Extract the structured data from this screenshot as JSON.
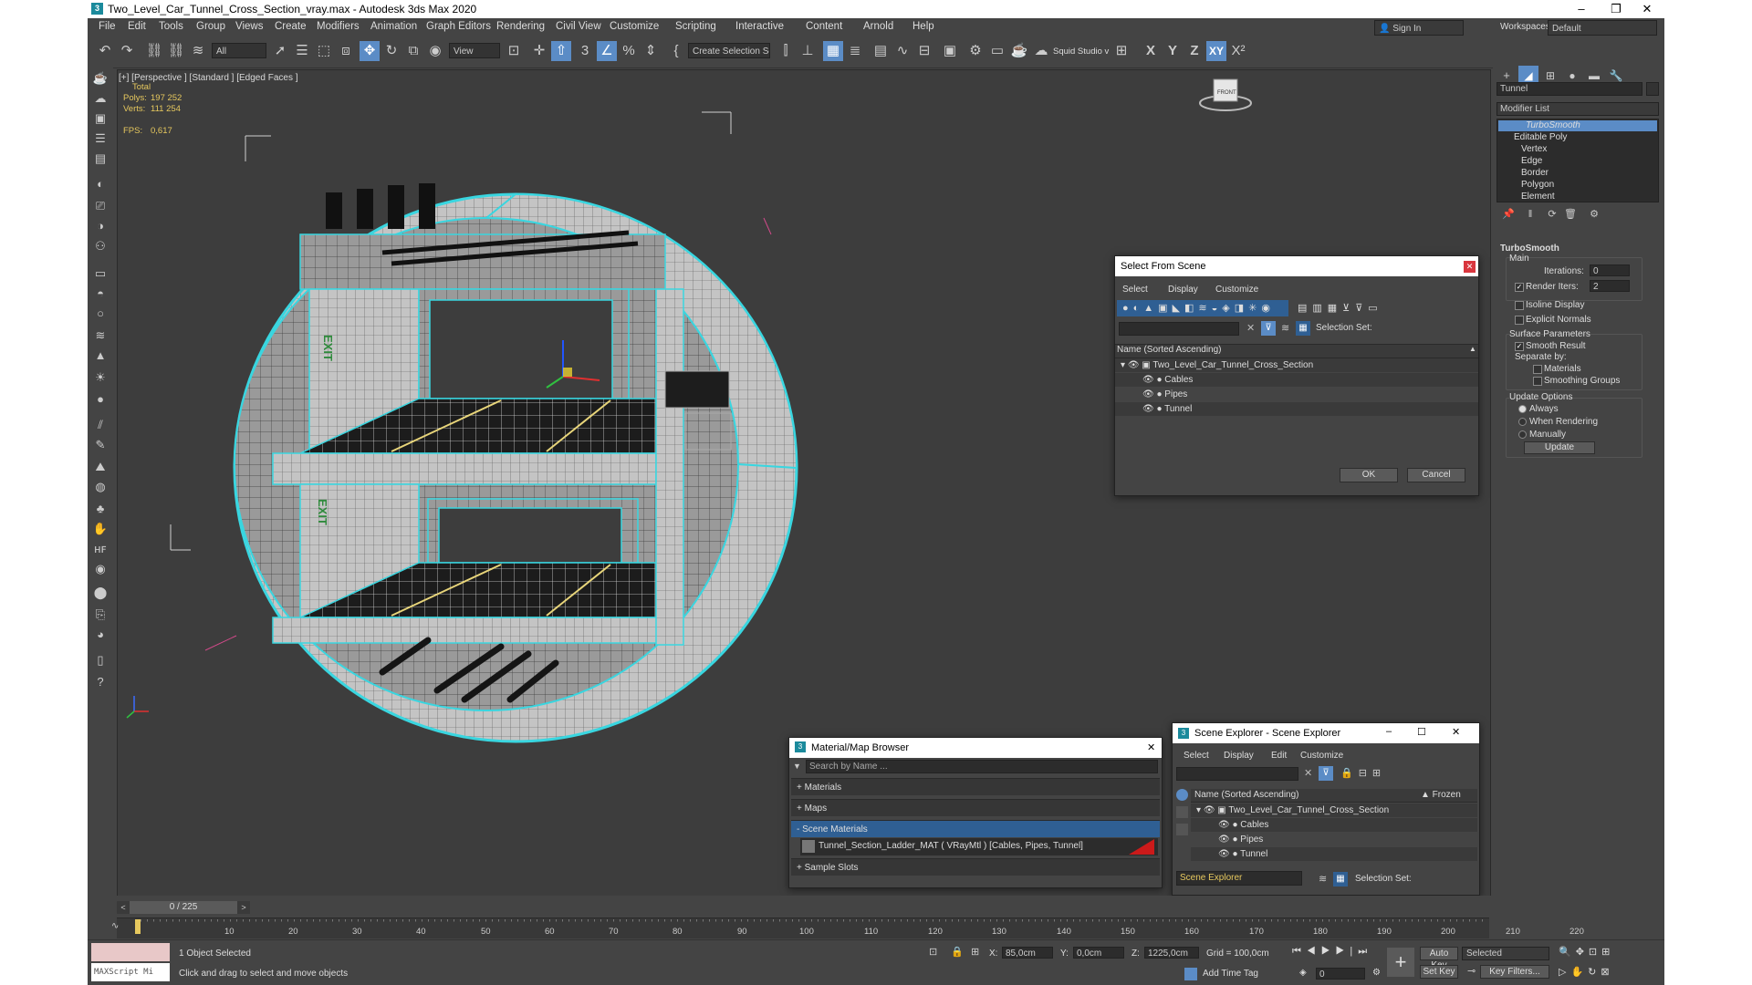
{
  "window": {
    "title": "Two_Level_Car_Tunnel_Cross_Section_vray.max - Autodesk 3ds Max 2020",
    "app_icon": "3"
  },
  "menu": [
    "File",
    "Edit",
    "Tools",
    "Group",
    "Views",
    "Create",
    "Modifiers",
    "Animation",
    "Graph Editors",
    "Rendering",
    "Civil View",
    "Customize",
    "Scripting",
    "Interactive",
    "Content",
    "Arnold",
    "Help"
  ],
  "signin": {
    "label": "Sign In"
  },
  "workspaces": {
    "label": "Workspaces:",
    "value": "Default"
  },
  "toolbar": {
    "filter_value": "All",
    "ref_coord_value": "View",
    "selection_set_value": "Create Selection Se",
    "squid_label": "Squid Studio v",
    "axis_labels": [
      "X",
      "Y",
      "Z",
      "XY"
    ]
  },
  "viewport": {
    "label": "[+] [Perspective ] [Standard ] [Edged Faces ]",
    "stats": {
      "total_label": "Total",
      "polys_label": "Polys:",
      "polys_value": "197 252",
      "verts_label": "Verts:",
      "verts_value": "111 254",
      "fps_label": "FPS:",
      "fps_value": "0,617"
    },
    "viewcube_label": "FRONT",
    "exit_sign": "EXIT"
  },
  "cmdpanel": {
    "object_name": "Tunnel",
    "modifier_list": "Modifier List",
    "stack": [
      "TurboSmooth",
      "Editable Poly",
      "Vertex",
      "Edge",
      "Border",
      "Polygon",
      "Element"
    ],
    "rollout_title": "TurboSmooth",
    "main_label": "Main",
    "iterations_label": "Iterations:",
    "iterations_value": "0",
    "render_iters_label": "Render Iters:",
    "render_iters_value": "2",
    "isoline_label": "Isoline Display",
    "explicit_label": "Explicit Normals",
    "surface_label": "Surface Parameters",
    "smooth_result_label": "Smooth Result",
    "separate_label": "Separate by:",
    "materials_label": "Materials",
    "smoothing_groups_label": "Smoothing Groups",
    "update_options_label": "Update Options",
    "always_label": "Always",
    "when_rendering_label": "When Rendering",
    "manually_label": "Manually",
    "update_button": "Update"
  },
  "select_from_scene": {
    "title": "Select From Scene",
    "menu": [
      "Select",
      "Display",
      "Customize"
    ],
    "selection_set_label": "Selection Set:",
    "column_header": "Name (Sorted Ascending)",
    "root": "Two_Level_Car_Tunnel_Cross_Section",
    "children": [
      "Cables",
      "Pipes",
      "Tunnel"
    ],
    "ok": "OK",
    "cancel": "Cancel"
  },
  "material_browser": {
    "title": "Material/Map Browser",
    "search_placeholder": "Search by Name ...",
    "rows": [
      "+ Materials",
      "+ Maps",
      "- Scene Materials"
    ],
    "material_entry": "Tunnel_Section_Ladder_MAT ( VRayMtl ) [Cables, Pipes, Tunnel]",
    "sample_slots": "+ Sample Slots"
  },
  "scene_explorer": {
    "title": "Scene Explorer - Scene Explorer",
    "menu": [
      "Select",
      "Display",
      "Edit",
      "Customize"
    ],
    "column_header": "Name (Sorted Ascending)",
    "frozen_header": "▲ Frozen",
    "root": "Two_Level_Car_Tunnel_Cross_Section",
    "children": [
      "Cables",
      "Pipes",
      "Tunnel"
    ],
    "footer_name": "Scene Explorer",
    "selection_set_label": "Selection Set:"
  },
  "timeline": {
    "frame_display": "0 / 225",
    "ticks": [
      "10",
      "20",
      "30",
      "40",
      "50",
      "60",
      "70",
      "80",
      "90",
      "100",
      "110",
      "120",
      "130",
      "140",
      "150",
      "160",
      "170",
      "180",
      "190",
      "200",
      "210",
      "220"
    ]
  },
  "status": {
    "maxscript_label": "MAXScript Mi",
    "selected_text": "1 Object Selected",
    "prompt_text": "Click and drag to select and move objects",
    "x_label": "X:",
    "x_value": "85,0cm",
    "y_label": "Y:",
    "y_value": "0,0cm",
    "z_label": "Z:",
    "z_value": "1225,0cm",
    "grid_text": "Grid = 100,0cm",
    "add_time_tag": "Add Time Tag",
    "auto_key": "Auto Key",
    "set_key": "Set Key",
    "selected_dropdown": "Selected",
    "key_filters": "Key Filters...",
    "frame_field": "0"
  }
}
